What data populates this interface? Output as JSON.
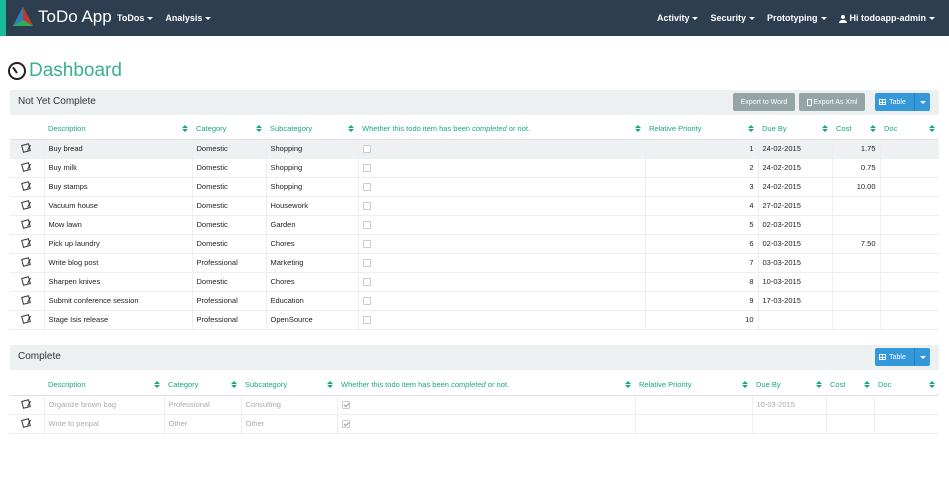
{
  "navbar": {
    "brand": "ToDo App",
    "left_menu": [
      "ToDos",
      "Analysis"
    ],
    "right_menu": [
      "Activity",
      "Security",
      "Prototyping",
      "Hi todoapp-admin"
    ],
    "colors": {
      "background": "#2c3e50",
      "accent": "#18bc9c"
    }
  },
  "page": {
    "title": "Dashboard",
    "title_color": "#3aaf91"
  },
  "not_yet_complete": {
    "label": "Not Yet Complete",
    "buttons": {
      "export_word": "Export to Word",
      "export_xml": "Export As Xml",
      "table": "Table"
    },
    "columns": [
      "Description",
      "Category",
      "Subcategory",
      "Whether this todo item has been",
      "completed",
      "or not.",
      "Relative Priority",
      "Due By",
      "Cost",
      "Doc"
    ],
    "rows": [
      {
        "description": "Buy bread",
        "category": "Domestic",
        "subcategory": "Shopping",
        "priority": "1",
        "due": "24-02-2015",
        "cost": "1.75"
      },
      {
        "description": "Buy milk",
        "category": "Domestic",
        "subcategory": "Shopping",
        "priority": "2",
        "due": "24-02-2015",
        "cost": "0.75"
      },
      {
        "description": "Buy stamps",
        "category": "Domestic",
        "subcategory": "Shopping",
        "priority": "3",
        "due": "24-02-2015",
        "cost": "10.00"
      },
      {
        "description": "Vacuum house",
        "category": "Domestic",
        "subcategory": "Housework",
        "priority": "4",
        "due": "27-02-2015",
        "cost": ""
      },
      {
        "description": "Mow lawn",
        "category": "Domestic",
        "subcategory": "Garden",
        "priority": "5",
        "due": "02-03-2015",
        "cost": ""
      },
      {
        "description": "Pick up laundry",
        "category": "Domestic",
        "subcategory": "Chores",
        "priority": "6",
        "due": "02-03-2015",
        "cost": "7.50"
      },
      {
        "description": "Write blog post",
        "category": "Professional",
        "subcategory": "Marketing",
        "priority": "7",
        "due": "03-03-2015",
        "cost": ""
      },
      {
        "description": "Sharpen knives",
        "category": "Domestic",
        "subcategory": "Chores",
        "priority": "8",
        "due": "10-03-2015",
        "cost": ""
      },
      {
        "description": "Submit conference session",
        "category": "Professional",
        "subcategory": "Education",
        "priority": "9",
        "due": "17-03-2015",
        "cost": ""
      },
      {
        "description": "Stage Isis release",
        "category": "Professional",
        "subcategory": "OpenSource",
        "priority": "10",
        "due": "",
        "cost": ""
      }
    ]
  },
  "complete": {
    "label": "Complete",
    "buttons": {
      "table": "Table"
    },
    "columns": [
      "Description",
      "Category",
      "Subcategory",
      "Whether this todo item has been",
      "completed",
      "or not.",
      "Relative Priority",
      "Due By",
      "Cost",
      "Doc"
    ],
    "rows": [
      {
        "description": "Organize brown bag",
        "category": "Professional",
        "subcategory": "Consulting",
        "priority": "",
        "due": "10-03-2015",
        "cost": ""
      },
      {
        "description": "Write to penpal",
        "category": "Other",
        "subcategory": "Other",
        "priority": "",
        "due": "",
        "cost": ""
      }
    ]
  }
}
